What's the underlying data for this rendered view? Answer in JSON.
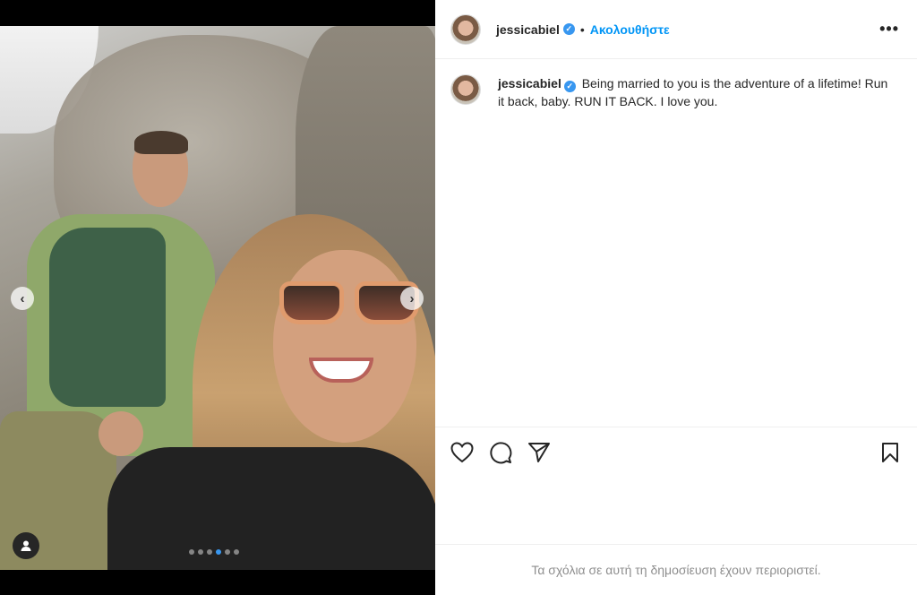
{
  "post": {
    "username": "jessicabiel",
    "verified_mark": "✓",
    "separator": "•",
    "follow_label": "Ακολουθήστε",
    "more_label": "•••",
    "caption": "Being married to you is the adventure of a lifetime! Run it back, baby. RUN IT BACK. I love you.",
    "comments_restricted": "Τα σχόλια σε αυτή τη δημοσίευση έχουν περιοριστεί."
  },
  "carousel": {
    "prev_glyph": "‹",
    "next_glyph": "›",
    "slide_count": 6,
    "active_slide": 4
  },
  "colors": {
    "accent": "#0095f6",
    "verified": "#3897f0",
    "text": "#262626",
    "muted": "#8e8e8e"
  },
  "icons": [
    "heart-icon",
    "comment-icon",
    "share-icon",
    "bookmark-icon",
    "user-tag-icon",
    "chevron-left-icon",
    "chevron-right-icon",
    "verified-badge-icon",
    "more-icon"
  ]
}
